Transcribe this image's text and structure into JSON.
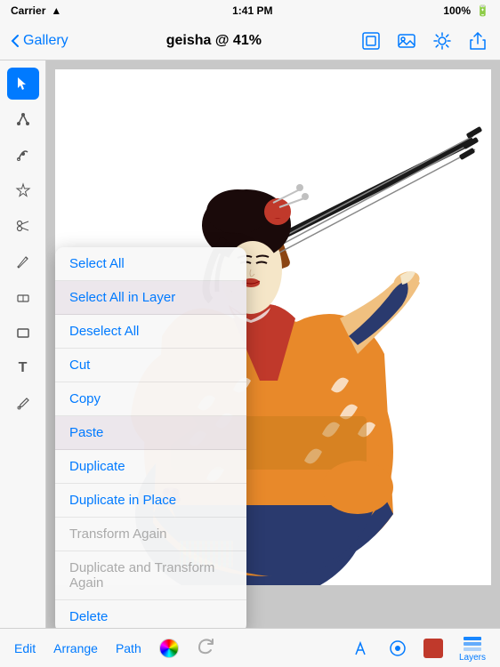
{
  "statusBar": {
    "carrier": "Carrier",
    "wifi": "wifi",
    "time": "1:41 PM",
    "battery": "100%"
  },
  "navBar": {
    "backLabel": "Gallery",
    "title": "geisha @ 41%",
    "icons": [
      "frame-icon",
      "image-icon",
      "settings-icon",
      "share-icon"
    ]
  },
  "toolbar": {
    "tools": [
      {
        "name": "select-tool",
        "icon": "↖",
        "active": true
      },
      {
        "name": "node-tool",
        "icon": "✦",
        "active": false
      },
      {
        "name": "pen-tool",
        "icon": "✒",
        "active": false
      },
      {
        "name": "star-tool",
        "icon": "✳",
        "active": false
      },
      {
        "name": "scissors-tool",
        "icon": "✂",
        "active": false
      },
      {
        "name": "pencil-tool",
        "icon": "✏",
        "active": false
      },
      {
        "name": "eraser-tool",
        "icon": "◻",
        "active": false
      },
      {
        "name": "rectangle-tool",
        "icon": "▭",
        "active": false
      },
      {
        "name": "text-tool",
        "icon": "T",
        "active": false
      },
      {
        "name": "eyedropper-tool",
        "icon": "⟆",
        "active": false
      }
    ]
  },
  "contextMenu": {
    "items": [
      {
        "label": "Select All",
        "state": "normal",
        "name": "select-all"
      },
      {
        "label": "Select All in Layer",
        "state": "normal",
        "name": "select-all-in-layer"
      },
      {
        "label": "Deselect All",
        "state": "normal",
        "name": "deselect-all"
      },
      {
        "label": "Cut",
        "state": "normal",
        "name": "cut"
      },
      {
        "label": "Copy",
        "state": "normal",
        "name": "copy"
      },
      {
        "label": "Paste",
        "state": "highlighted",
        "name": "paste"
      },
      {
        "label": "Duplicate",
        "state": "normal",
        "name": "duplicate"
      },
      {
        "label": "Duplicate in Place",
        "state": "normal",
        "name": "duplicate-in-place"
      },
      {
        "label": "Transform Again",
        "state": "disabled",
        "name": "transform-again"
      },
      {
        "label": "Duplicate and Transform Again",
        "state": "disabled",
        "name": "duplicate-transform-again"
      },
      {
        "label": "Delete",
        "state": "normal",
        "name": "delete"
      }
    ]
  },
  "bottomBar": {
    "editLabel": "Edit",
    "arrangeLabel": "Arrange",
    "pathLabel": "Path",
    "layersLabel": "Layers"
  }
}
